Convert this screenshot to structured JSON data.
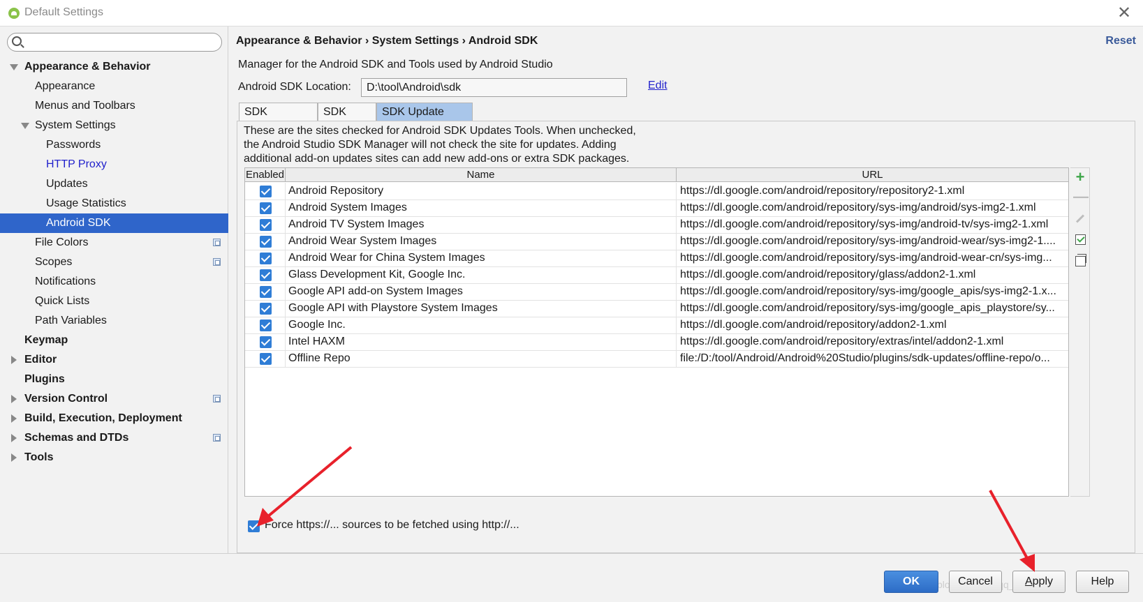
{
  "window": {
    "title": "Default Settings",
    "close": "✕"
  },
  "search": {
    "value": "",
    "placeholder": ""
  },
  "sidebar": {
    "items": [
      {
        "label": "Appearance & Behavior"
      },
      {
        "label": "Appearance"
      },
      {
        "label": "Menus and Toolbars"
      },
      {
        "label": "System Settings"
      },
      {
        "label": "Passwords"
      },
      {
        "label": "HTTP Proxy"
      },
      {
        "label": "Updates"
      },
      {
        "label": "Usage Statistics"
      },
      {
        "label": "Android SDK"
      },
      {
        "label": "File Colors"
      },
      {
        "label": "Scopes"
      },
      {
        "label": "Notifications"
      },
      {
        "label": "Quick Lists"
      },
      {
        "label": "Path Variables"
      },
      {
        "label": "Keymap"
      },
      {
        "label": "Editor"
      },
      {
        "label": "Plugins"
      },
      {
        "label": "Version Control"
      },
      {
        "label": "Build, Execution, Deployment"
      },
      {
        "label": "Schemas and DTDs"
      },
      {
        "label": "Tools"
      }
    ]
  },
  "main": {
    "breadcrumb": "Appearance & Behavior › System Settings › Android SDK",
    "reset": "Reset",
    "description": "Manager for the Android SDK and Tools used by Android Studio",
    "location_label": "Android SDK Location:",
    "location_value": "D:\\tool\\Android\\sdk",
    "edit": "Edit",
    "tabs": [
      {
        "label": "SDK Platforms"
      },
      {
        "label": "SDK Tools"
      },
      {
        "label": "SDK Update Sites"
      }
    ],
    "panel_desc_1": "These are the sites checked for Android SDK Updates Tools. When unchecked,",
    "panel_desc_2": "the Android Studio SDK Manager will not check the site for updates. Adding",
    "panel_desc_3": "additional add-on updates sites can add new add-ons or extra SDK packages.",
    "table": {
      "headers": {
        "enabled": "Enabled",
        "name": "Name",
        "url": "URL"
      },
      "rows": [
        {
          "name": "Android Repository",
          "url": "https://dl.google.com/android/repository/repository2-1.xml"
        },
        {
          "name": "Android System Images",
          "url": "https://dl.google.com/android/repository/sys-img/android/sys-img2-1.xml"
        },
        {
          "name": "Android TV System Images",
          "url": "https://dl.google.com/android/repository/sys-img/android-tv/sys-img2-1.xml"
        },
        {
          "name": "Android Wear System Images",
          "url": "https://dl.google.com/android/repository/sys-img/android-wear/sys-img2-1...."
        },
        {
          "name": "Android Wear for China System Images",
          "url": "https://dl.google.com/android/repository/sys-img/android-wear-cn/sys-img..."
        },
        {
          "name": "Glass Development Kit, Google Inc.",
          "url": "https://dl.google.com/android/repository/glass/addon2-1.xml"
        },
        {
          "name": "Google API add-on System Images",
          "url": "https://dl.google.com/android/repository/sys-img/google_apis/sys-img2-1.x..."
        },
        {
          "name": "Google API with Playstore System Images",
          "url": "https://dl.google.com/android/repository/sys-img/google_apis_playstore/sy..."
        },
        {
          "name": "Google Inc.",
          "url": "https://dl.google.com/android/repository/addon2-1.xml"
        },
        {
          "name": "Intel HAXM",
          "url": "https://dl.google.com/android/repository/extras/intel/addon2-1.xml"
        },
        {
          "name": "Offline Repo",
          "url": "file:/D:/tool/Android/Android%20Studio/plugins/sdk-updates/offline-repo/o..."
        }
      ]
    },
    "toolbar": {
      "add": "+",
      "remove": "—"
    },
    "force_http_label": "Force https://... sources to be fetched using http://..."
  },
  "footer": {
    "ok": "OK",
    "cancel": "Cancel",
    "apply_underlined": "A",
    "apply_rest": "pply",
    "help": "Help",
    "watermark": "https://blog.csdn.net/qq_2..."
  },
  "colors": {
    "selection": "#2f65ca",
    "checkbox": "#2f7dd6",
    "link": "#2222cc",
    "arrow": "#e8212b"
  }
}
